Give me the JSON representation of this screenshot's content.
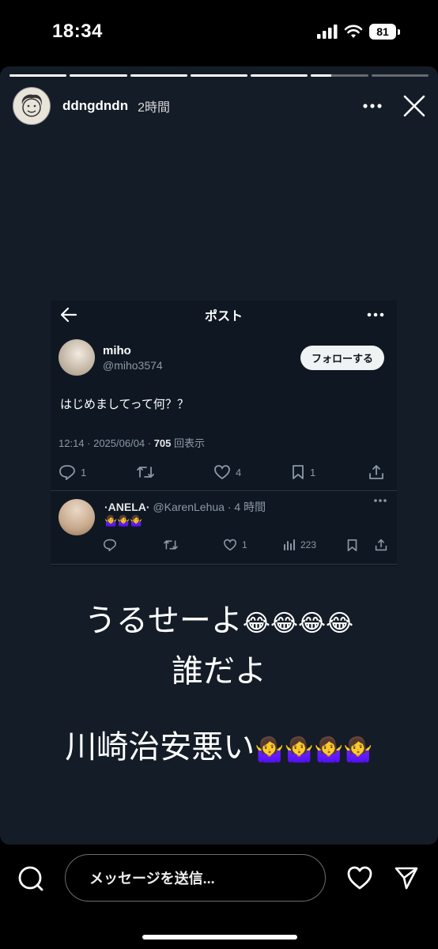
{
  "status_bar": {
    "time": "18:34",
    "battery": "81"
  },
  "story": {
    "progress": [
      1,
      1,
      1,
      1,
      1,
      0.35,
      0
    ],
    "username": "ddngdndn",
    "posted_ago": "2時間"
  },
  "tweet": {
    "title": "ポスト",
    "author_name": "miho",
    "author_handle": "@miho3574",
    "follow_label": "フォローする",
    "text": "はじめましてって何？？",
    "meta_prefix": "12:14 · 2025/06/04 · ",
    "views": "705",
    "views_suffix": " 回表示",
    "replies": "1",
    "likes": "4",
    "bookmarks": "1",
    "reply": {
      "name": "·ANELA·",
      "handle": "@KarenLehua",
      "time": "· 4 時間",
      "text": "🤷‍♀️🤷‍♀️🤷‍♀️",
      "likes": "1",
      "views": "223"
    }
  },
  "caption": {
    "line1": "うるせーよ",
    "line1_emoji": "😂😂😂😂",
    "line2": "誰だよ",
    "line3": "川崎治安悪い",
    "line3_emoji": "🤷‍♀️🤷‍♀️🤷‍♀️🤷‍♀️"
  },
  "bottom": {
    "message_placeholder": "メッセージを送信..."
  }
}
